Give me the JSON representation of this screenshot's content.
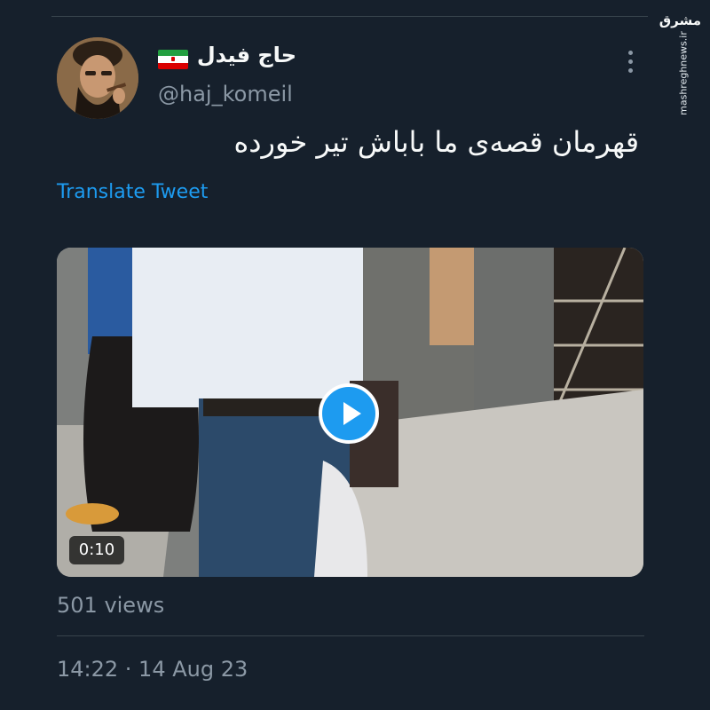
{
  "tweet": {
    "display_name": "حاج فیدل",
    "handle": "@haj_komeil",
    "text": "قهرمان قصه‌ی ما باباش تیر خورده",
    "translate_label": "Translate Tweet",
    "flag_icon": "iran-flag-icon",
    "more_icon": "more-dots-icon"
  },
  "video": {
    "duration": "0:10",
    "play_icon": "play-icon"
  },
  "stats": {
    "views": "501 views",
    "timestamp": "14:22 · 14 Aug 23"
  },
  "watermark": {
    "logo": "مشرق",
    "url": "mashreghnews.ir"
  },
  "colors": {
    "background": "#16202c",
    "accent": "#1d9bf0",
    "secondary_text": "#8b98a5",
    "divider": "#38444d"
  }
}
